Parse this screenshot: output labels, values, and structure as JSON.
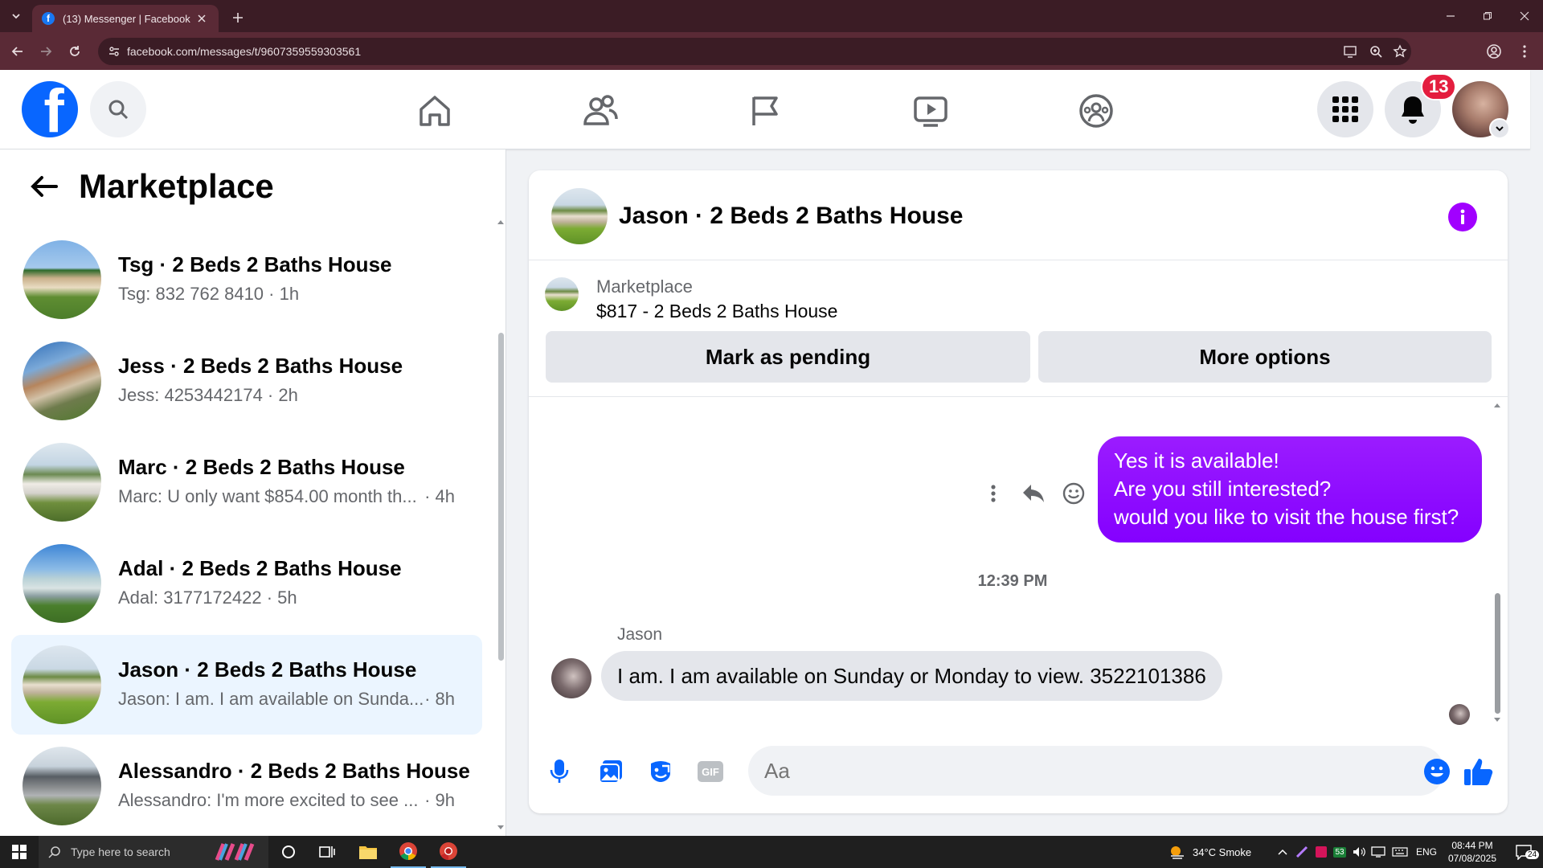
{
  "browser": {
    "tab_title": "(13) Messenger | Facebook",
    "url": "facebook.com/messages/t/9607359559303561",
    "new_tab_label": "+"
  },
  "fb_nav": {
    "logo_letter": "f",
    "notification_count": "13"
  },
  "sidebar": {
    "title": "Marketplace",
    "conversations": [
      {
        "name": "Tsg · 2 Beds 2 Baths House",
        "preview": "Tsg: 832 762 8410 · 1h",
        "time": ""
      },
      {
        "name": "Jess · 2 Beds 2 Baths House",
        "preview": "Jess: 4253442174 · 2h",
        "time": ""
      },
      {
        "name": "Marc · 2 Beds 2 Baths House",
        "preview": "Marc: U only want $854.00 month th...",
        "time": "· 4h"
      },
      {
        "name": "Adal · 2 Beds 2 Baths House",
        "preview": "Adal: 3177172422 · 5h",
        "time": ""
      },
      {
        "name": "Jason · 2 Beds 2 Baths House",
        "preview": "Jason: I am. I am available on Sunda...",
        "time": "· 8h"
      },
      {
        "name": "Alessandro · 2 Beds 2 Baths House",
        "preview": "Alessandro: I'm more excited to see ...",
        "time": "· 9h"
      }
    ]
  },
  "chat": {
    "title": "Jason · 2 Beds 2 Baths House",
    "marketplace_label": "Marketplace",
    "listing": "$817 - 2 Beds 2 Baths House",
    "mark_pending": "Mark as pending",
    "more_options": "More options",
    "outgoing": [
      "Yes it is available!",
      "Are you still interested?",
      "would you like to visit the house first?"
    ],
    "timestamp": "12:39 PM",
    "incoming_sender": "Jason",
    "incoming_message": "I am. I am available on Sunday or Monday to view. 3522101386",
    "composer_placeholder": "Aa",
    "composer_gif": "GIF"
  },
  "taskbar": {
    "search_placeholder": "Type here to search",
    "weather": "34°C  Smoke",
    "lang": "ENG",
    "time": "08:44 PM",
    "date": "07/08/2025",
    "notif_count": "24",
    "tray_badge": "53"
  },
  "colors": {
    "fb_blue": "#0866ff",
    "messenger_purple": "#8a00ff",
    "browser_frame": "#3b1c25"
  }
}
